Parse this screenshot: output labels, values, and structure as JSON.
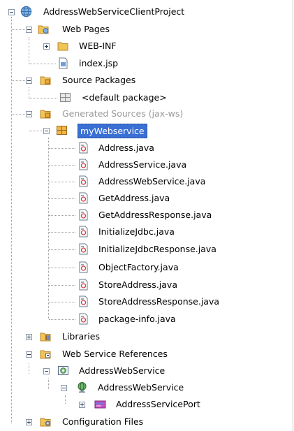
{
  "tree": {
    "project": "AddressWebServiceClientProject",
    "web_pages": "Web Pages",
    "web_inf": "WEB-INF",
    "index_jsp": "index.jsp",
    "source_packages": "Source Packages",
    "default_package": "<default package>",
    "generated_sources": "Generated Sources (jax-ws)",
    "my_webservice": "myWebservice",
    "java_files": [
      "Address.java",
      "AddressService.java",
      "AddressWebService.java",
      "GetAddress.java",
      "GetAddressResponse.java",
      "InitializeJdbc.java",
      "InitializeJdbcResponse.java",
      "ObjectFactory.java",
      "StoreAddress.java",
      "StoreAddressResponse.java",
      "package-info.java"
    ],
    "libraries": "Libraries",
    "web_service_references": "Web Service References",
    "ref_address_web_service": "AddressWebService",
    "svc_address_web_service": "AddressWebService",
    "address_service_port": "AddressServicePort",
    "configuration_files": "Configuration Files"
  },
  "colors": {
    "selection": "#3a6fd3",
    "folder": "#e9b64a",
    "package": "#e8a63b"
  }
}
